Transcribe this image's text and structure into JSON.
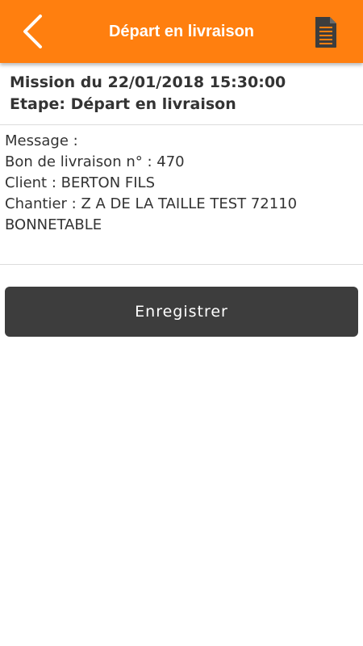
{
  "topbar": {
    "title": "Départ en livraison",
    "back_icon": "chevron-left-icon",
    "doc_icon": "document-icon",
    "background_color": "#ff7f0f"
  },
  "mission": {
    "line1": "Mission du 22/01/2018 15:30:00",
    "line2": "Etape: Départ en livraison"
  },
  "details": {
    "message": "Message :",
    "bon": "Bon de livraison n° : 470",
    "client": "Client : BERTON FILS",
    "chantier": "Chantier : Z A DE LA TAILLE TEST 72110",
    "city": "BONNETABLE"
  },
  "actions": {
    "save_label": "Enregistrer",
    "save_color": "#3d3d3d"
  }
}
